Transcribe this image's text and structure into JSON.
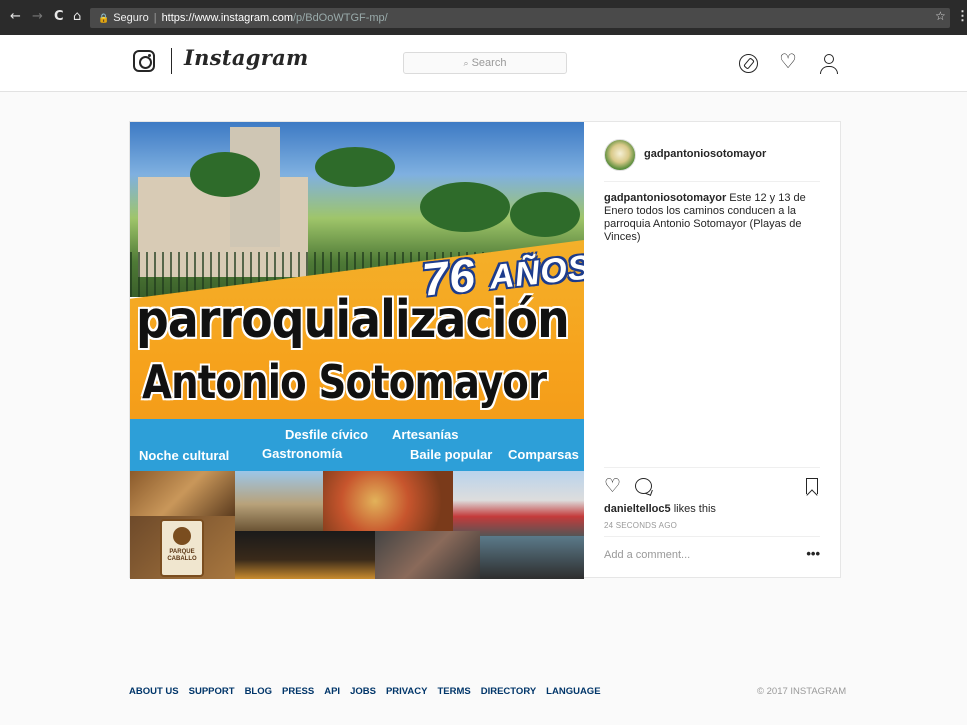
{
  "browser": {
    "back": "←",
    "forward": "→",
    "reload": "C",
    "home": "⌂",
    "lock": "🔒",
    "secure_label": "Seguro",
    "url_host": "https://www.instagram.com",
    "url_path": "/p/BdOoWTGF-mp/",
    "star": "☆",
    "menu": "⋮"
  },
  "header": {
    "wordmark": "Instagram",
    "search_placeholder": "Search",
    "heart": "♡"
  },
  "poster": {
    "years_number": "76",
    "years_word": "AÑOS",
    "headline_1": "parroquialización",
    "headline_2": "Antonio Sotomayor",
    "tags": [
      "Desfile cívico",
      "Artesanías",
      "Noche cultural",
      "Gastronomía",
      "Baile popular",
      "Comparsas"
    ],
    "collage_sign": "PARQUE CABALLO"
  },
  "post": {
    "owner": "gadpantoniosotomayor",
    "caption_user": "gadpantoniosotomayor",
    "caption_text": "Este 12 y 13 de Enero todos los caminos conducen a la parroquia Antonio Sotomayor (Playas de Vinces)",
    "like_glyph": "♡",
    "likes_user": "danieltelloc5",
    "likes_suffix": "likes this",
    "time": "24 SECONDS AGO",
    "comment_placeholder": "Add a comment...",
    "more": "•••"
  },
  "footer": {
    "links": [
      "ABOUT US",
      "SUPPORT",
      "BLOG",
      "PRESS",
      "API",
      "JOBS",
      "PRIVACY",
      "TERMS",
      "DIRECTORY",
      "LANGUAGE"
    ],
    "copyright": "© 2017 INSTAGRAM"
  },
  "colors": {
    "link": "#003569",
    "orange": "#f6a21c",
    "blue_band": "#2d9fd8"
  }
}
